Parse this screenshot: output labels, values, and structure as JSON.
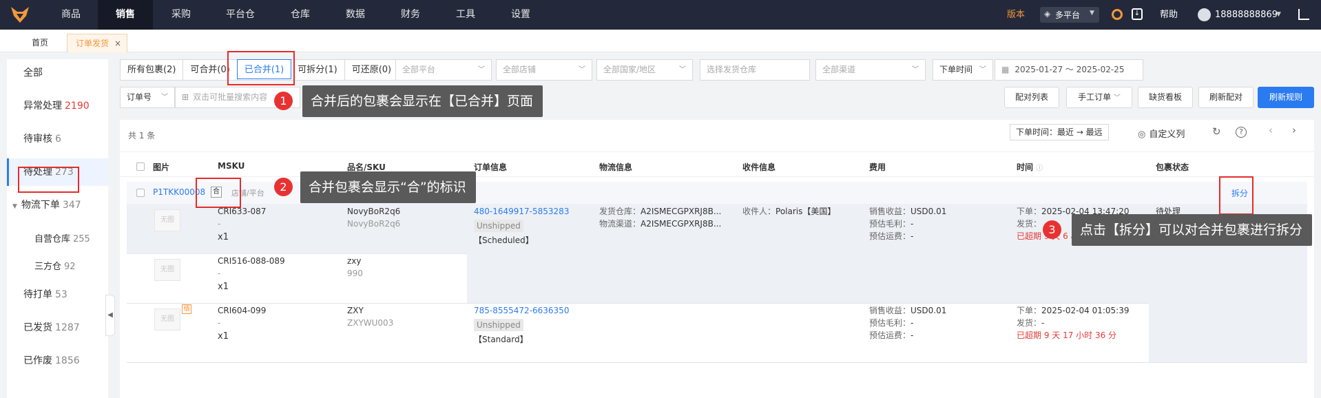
{
  "topnav": {
    "items": [
      "商品",
      "销售",
      "采购",
      "平台仓",
      "仓库",
      "数据",
      "财务",
      "工具",
      "设置"
    ],
    "active": "销售",
    "version": "版本",
    "platform": "多平台",
    "help": "帮助",
    "phone": "18888888869"
  },
  "tabs": {
    "home": "首页",
    "current": "订单发货",
    "close": "×"
  },
  "sidebar": {
    "items": [
      {
        "label": "全部",
        "count": ""
      },
      {
        "label": "异常处理",
        "count": "2190"
      },
      {
        "label": "待审核",
        "count": "6"
      },
      {
        "label": "待处理",
        "count": "273"
      },
      {
        "label": "物流下单",
        "count": "347"
      },
      {
        "label": "自营仓库",
        "count": "255"
      },
      {
        "label": "三方仓",
        "count": "92"
      },
      {
        "label": "待打单",
        "count": "53"
      },
      {
        "label": "已发货",
        "count": "1287"
      },
      {
        "label": "已作废",
        "count": "1856"
      }
    ]
  },
  "filters": {
    "segments": [
      "所有包裹(2)",
      "可合并(0)",
      "已合并(1)",
      "可拆分(1)",
      "可还原(0)"
    ],
    "active_segment": "已合并(1)",
    "platform": "全部平台",
    "store": "全部店铺",
    "country": "全部国家/地区",
    "warehouse": "选择发货仓库",
    "channel": "全部渠道",
    "time_type": "下单时间",
    "date_range": "2025-01-27 ～ 2025-02-25",
    "search_field": "订单号",
    "search_placeholder": "双击可批量搜索内容"
  },
  "actions": {
    "match_list": "配对列表",
    "manual_order": "手工订单",
    "shortage_board": "缺货看板",
    "refresh_match": "刷新配对",
    "refresh_rules": "刷新规则"
  },
  "table": {
    "total": "共 1 条",
    "sort": "下单时间：最近 → 最远",
    "custom_columns": "自定义列",
    "headers": [
      "图片",
      "MSKU",
      "品名/SKU",
      "订单信息",
      "物流信息",
      "收件信息",
      "费用",
      "时间",
      "包裹状态"
    ],
    "package": {
      "id": "P1TKK00008",
      "merge_tag": "合",
      "store_prefix": "店铺/平台",
      "split": "拆分",
      "status": "待处理"
    },
    "no_image": "无图",
    "add_tag": "缅",
    "rows": [
      {
        "msku": "CRI633-087",
        "dash": "-",
        "qty": "x1",
        "name": "NovyBoR2q6",
        "sku": "NovyBoR2q6"
      },
      {
        "msku": "CRI516-088-089",
        "dash": "-",
        "qty": "x1",
        "name": "zxy",
        "sku": "990"
      },
      {
        "msku": "CRI604-099",
        "dash": "-",
        "qty": "x1",
        "name": "ZXY",
        "sku": "ZXYWU003"
      }
    ],
    "order1": {
      "no": "480-1649917-5853283",
      "status": "Unshipped",
      "type": "【Scheduled】"
    },
    "order2": {
      "no": "785-8555472-6636350",
      "status": "Unshipped",
      "type": "【Standard】"
    },
    "logistics": {
      "warehouse_label": "发货仓库：",
      "warehouse": "A2ISMECGPXRJ8B...",
      "channel_label": "物流渠道：",
      "channel": "A2ISMECGPXRJ8B..."
    },
    "recipient": {
      "label": "收件人：",
      "name": "Polaris【美国】"
    },
    "fees": {
      "revenue_label": "销售收益：",
      "revenue": "USD0.01",
      "margin_label": "预估毛利：",
      "margin": "-",
      "shipping_label": "预估运费：",
      "shipping": "-"
    },
    "time1": {
      "order_label": "下单：",
      "order": "2025-02-04 13:47:20",
      "ship_label": "发货：",
      "overdue": "已超期 9 天 6 小时 29 分"
    },
    "time2": {
      "order_label": "下单：",
      "order": "2025-02-04 01:05:39",
      "ship_label": "发货：",
      "ship": "-",
      "overdue": "已超期 9 天 17 小时 36 分"
    }
  },
  "callouts": [
    {
      "num": "1",
      "text": "合并后的包裹会显示在【已合并】页面"
    },
    {
      "num": "2",
      "text": "合并包裹会显示“合”的标识"
    },
    {
      "num": "3",
      "text": "点击【拆分】可以对合并包裹进行拆分"
    }
  ],
  "colors": {
    "accent": "#2b7bf0",
    "topbar": "#23293a",
    "warning": "#e53935",
    "brand": "#f5973b"
  }
}
